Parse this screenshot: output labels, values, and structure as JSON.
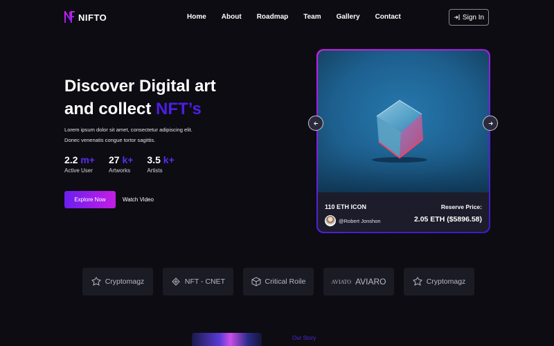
{
  "brand": {
    "name": "NIFTO"
  },
  "nav": {
    "links": [
      "Home",
      "About",
      "Roadmap",
      "Team",
      "Gallery",
      "Contact"
    ],
    "signin_label": "Sign In"
  },
  "hero": {
    "title_line1": "Discover Digital art",
    "title_line2_prefix": "and collect ",
    "title_line2_accent": "NFT’s",
    "description_line1": "Lorem ipsum dolor sit amet, consectetur adipiscing elit.",
    "description_line2": "Donec venenatis congue tortor sagittis.",
    "stats": [
      {
        "value": "2.2",
        "unit": "m+",
        "label": "Active User"
      },
      {
        "value": "27",
        "unit": "k+",
        "label": "Artworks"
      },
      {
        "value": "3.5",
        "unit": "k+",
        "label": "Artists"
      }
    ],
    "explore_label": "Explore Now",
    "watch_label": "Watch Video"
  },
  "featured": {
    "name": "110 ETH ICON",
    "owner": "@Robert Jonshon",
    "reserve_label": "Reserve Price:",
    "price": "2.05 ETH ($5896.58)"
  },
  "partners": [
    {
      "name": "Cryptomagz",
      "icon": "cryptomagz-icon"
    },
    {
      "name": "NFT - CNET",
      "icon": "cnet-icon"
    },
    {
      "name": "Critical Roile",
      "icon": "cube-icon"
    },
    {
      "name": "AVIARO",
      "icon": "aviato-icon",
      "logo_small_text": "AVIATO"
    },
    {
      "name": "Cryptomagz",
      "icon": "cryptomagz-icon"
    }
  ],
  "story": {
    "label": "Our Story"
  },
  "colors": {
    "background": "#0d0c12",
    "accent": "#4b1ee6",
    "button_gradient_start": "#6a1ff0",
    "button_gradient_end": "#c41ee6",
    "card_info_bg": "#1c1c2a",
    "partner_bg": "#1b1b24"
  }
}
